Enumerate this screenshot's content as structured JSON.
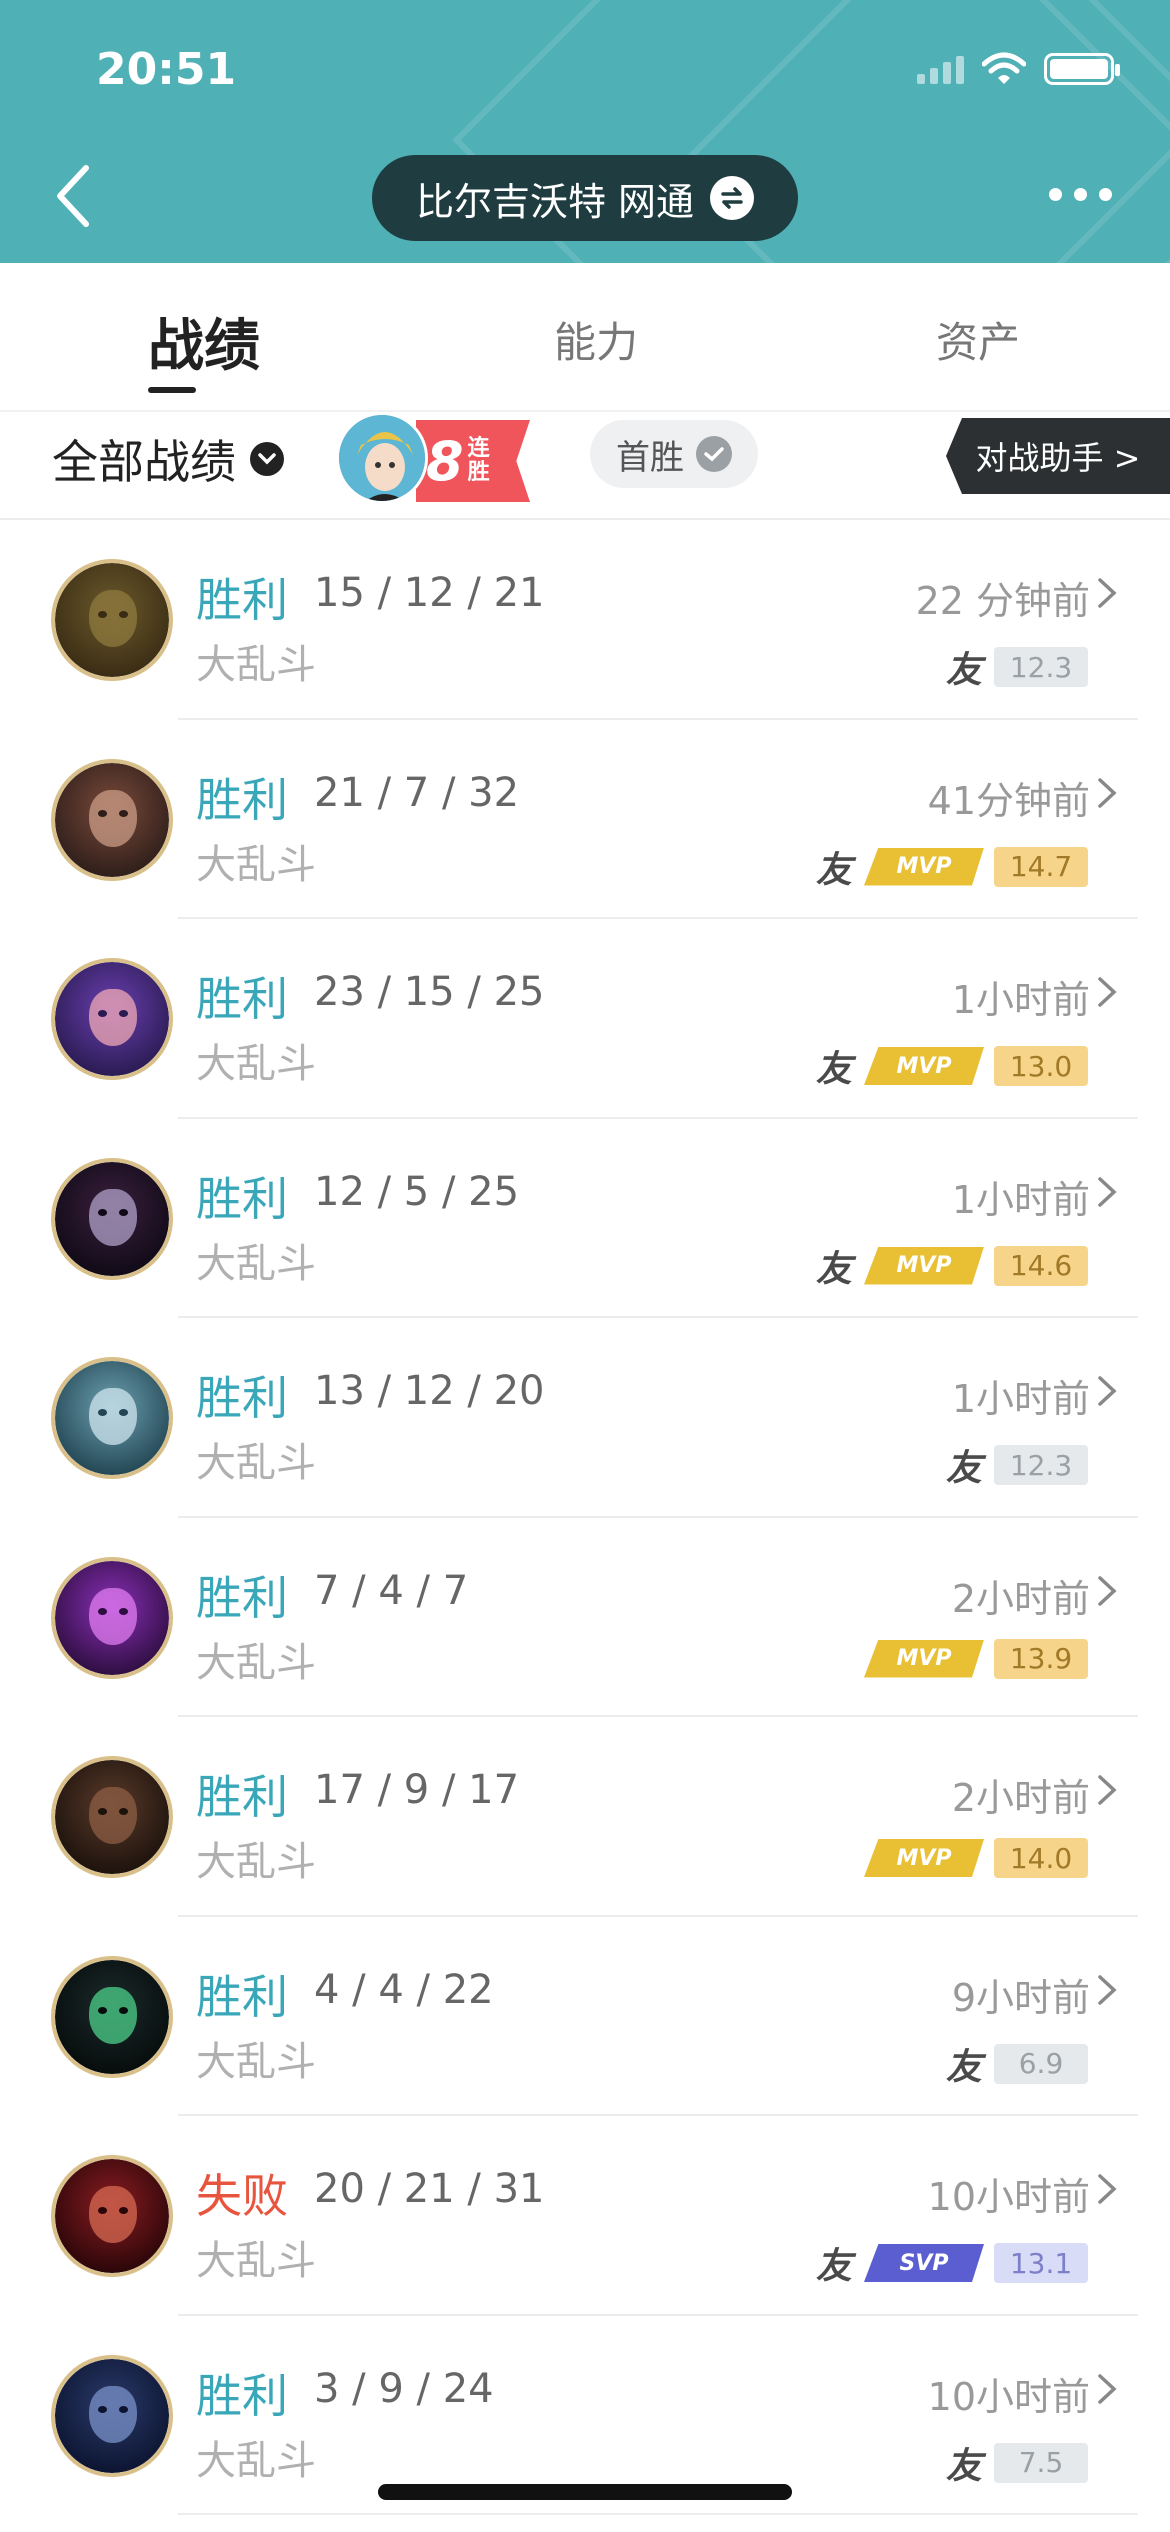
{
  "status_bar": {
    "time": "20:51"
  },
  "header": {
    "server_label": "比尔吉沃特 网通"
  },
  "tabs": [
    {
      "label": "战绩",
      "active": true
    },
    {
      "label": "能力",
      "active": false
    },
    {
      "label": "资产",
      "active": false
    }
  ],
  "filter": {
    "all_label": "全部战绩",
    "streak_count": "8",
    "streak_text": "连胜",
    "first_win_label": "首胜",
    "assistant_label": "对战助手 >"
  },
  "matches": [
    {
      "result": "胜利",
      "kda": "15 / 12 / 21",
      "mode": "大乱斗",
      "time": "22 分钟前",
      "friend": "友",
      "badge": "",
      "score": "12.3",
      "score_style": "grey",
      "avatar_colors": [
        "#6b5a2c",
        "#3a2c14",
        "#8f7a3e"
      ]
    },
    {
      "result": "胜利",
      "kda": "21 / 7 / 32",
      "mode": "大乱斗",
      "time": "41分钟前",
      "friend": "友",
      "badge": "MVP",
      "score": "14.7",
      "score_style": "gold",
      "avatar_colors": [
        "#7a4a3a",
        "#2e1e1a",
        "#c99c85"
      ]
    },
    {
      "result": "胜利",
      "kda": "23 / 15 / 25",
      "mode": "大乱斗",
      "time": "1小时前",
      "friend": "友",
      "badge": "MVP",
      "score": "13.0",
      "score_style": "gold",
      "avatar_colors": [
        "#6a3fb0",
        "#2a1b52",
        "#f0a9b5"
      ]
    },
    {
      "result": "胜利",
      "kda": "12 / 5 / 25",
      "mode": "大乱斗",
      "time": "1小时前",
      "friend": "友",
      "badge": "MVP",
      "score": "14.6",
      "score_style": "gold",
      "avatar_colors": [
        "#3a1f3e",
        "#100a16",
        "#b0a2c8"
      ]
    },
    {
      "result": "胜利",
      "kda": "13 / 12 / 20",
      "mode": "大乱斗",
      "time": "1小时前",
      "friend": "友",
      "badge": "",
      "score": "12.3",
      "score_style": "grey",
      "avatar_colors": [
        "#6ca0b0",
        "#234654",
        "#cfe6ee"
      ]
    },
    {
      "result": "胜利",
      "kda": "7 / 4 / 7",
      "mode": "大乱斗",
      "time": "2小时前",
      "friend": "",
      "badge": "MVP",
      "score": "13.9",
      "score_style": "gold",
      "avatar_colors": [
        "#8a2fb8",
        "#2e0e40",
        "#e07cf0"
      ]
    },
    {
      "result": "胜利",
      "kda": "17 / 9 / 17",
      "mode": "大乱斗",
      "time": "2小时前",
      "friend": "",
      "badge": "MVP",
      "score": "14.0",
      "score_style": "gold",
      "avatar_colors": [
        "#5a3a2a",
        "#1c120c",
        "#8c5e44"
      ]
    },
    {
      "result": "胜利",
      "kda": "4 / 4 / 22",
      "mode": "大乱斗",
      "time": "9小时前",
      "friend": "友",
      "badge": "",
      "score": "6.9",
      "score_style": "grey",
      "avatar_colors": [
        "#1c2a2a",
        "#060c0c",
        "#4cd08a"
      ]
    },
    {
      "result": "失败",
      "kda": "20 / 21 / 31",
      "mode": "大乱斗",
      "time": "10小时前",
      "friend": "友",
      "badge": "SVP",
      "score": "13.1",
      "score_style": "blue",
      "avatar_colors": [
        "#8a1c22",
        "#2a0608",
        "#d56a52"
      ]
    },
    {
      "result": "胜利",
      "kda": "3 / 9 / 24",
      "mode": "大乱斗",
      "time": "10小时前",
      "friend": "友",
      "badge": "",
      "score": "7.5",
      "score_style": "grey",
      "avatar_colors": [
        "#2a3a6a",
        "#0c1430",
        "#7a92c8"
      ]
    }
  ]
}
